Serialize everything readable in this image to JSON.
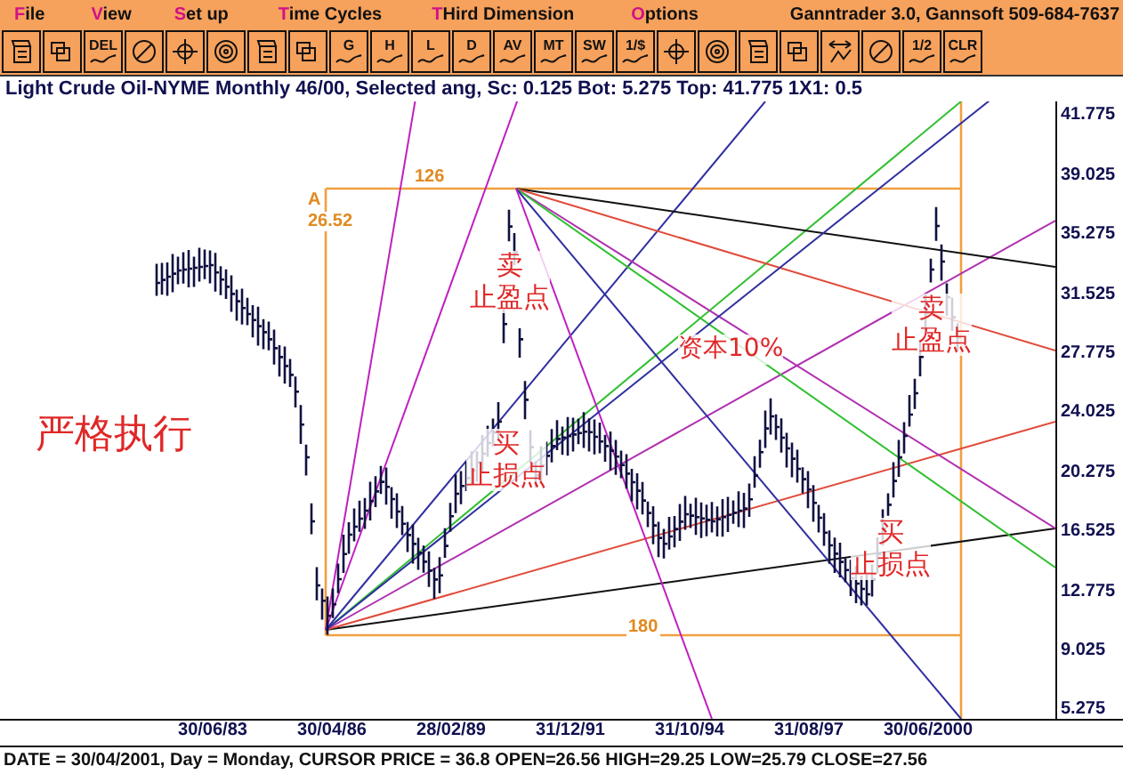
{
  "menu": [
    {
      "label": "File"
    },
    {
      "label": "View"
    },
    {
      "label": "Set up"
    },
    {
      "label": "Time Cycles"
    },
    {
      "label": "THird Dimension"
    },
    {
      "label": "Options"
    }
  ],
  "app_info": "Ganntrader 3.0, Gannsoft 509-684-7637",
  "toolbar": [
    {
      "kind": "icon"
    },
    {
      "kind": "icon"
    },
    {
      "kind": "text",
      "label": "DEL"
    },
    {
      "kind": "icon"
    },
    {
      "kind": "icon"
    },
    {
      "kind": "icon"
    },
    {
      "kind": "icon"
    },
    {
      "kind": "icon"
    },
    {
      "kind": "text",
      "label": "G"
    },
    {
      "kind": "text",
      "label": "H"
    },
    {
      "kind": "text",
      "label": "L"
    },
    {
      "kind": "text",
      "label": "D"
    },
    {
      "kind": "text",
      "label": "AV"
    },
    {
      "kind": "text",
      "label": "MT"
    },
    {
      "kind": "text",
      "label": "SW"
    },
    {
      "kind": "text",
      "label": "1/$"
    },
    {
      "kind": "icon"
    },
    {
      "kind": "icon"
    },
    {
      "kind": "icon"
    },
    {
      "kind": "icon"
    },
    {
      "kind": "icon"
    },
    {
      "kind": "icon"
    },
    {
      "kind": "text",
      "label": "1/2"
    },
    {
      "kind": "text",
      "label": "CLR"
    }
  ],
  "chart_title": "Light Crude Oil-NYME Monthly 46/00, Selected ang, Sc: 0.125 Bot: 5.275 Top: 41.775 1X1: 0.5",
  "price_axis": [
    "41.775",
    "39.025",
    "35.275",
    "31.525",
    "27.775",
    "24.025",
    "20.275",
    "16.525",
    "12.775",
    "9.025",
    "5.275"
  ],
  "date_axis": [
    "30/06/83",
    "30/04/86",
    "28/02/89",
    "31/12/91",
    "31/10/94",
    "31/08/97",
    "30/06/2000"
  ],
  "guide_labels": [
    {
      "text": "126"
    },
    {
      "text": "A"
    },
    {
      "text": "26.52"
    },
    {
      "text": "180"
    }
  ],
  "annotations": [
    {
      "lines": [
        "严格执行"
      ]
    },
    {
      "lines": [
        "卖",
        "止盈点"
      ]
    },
    {
      "lines": [
        "买",
        "止损点"
      ]
    },
    {
      "lines": [
        "资本10%"
      ]
    },
    {
      "lines": [
        "卖",
        "止盈点"
      ]
    },
    {
      "lines": [
        "买",
        "止损点"
      ]
    }
  ],
  "status_bar": "DATE = 30/04/2001, Day = Monday, CURSOR PRICE = 36.8 OPEN=26.56 HIGH=29.25 LOW=25.79 CLOSE=27.56"
}
